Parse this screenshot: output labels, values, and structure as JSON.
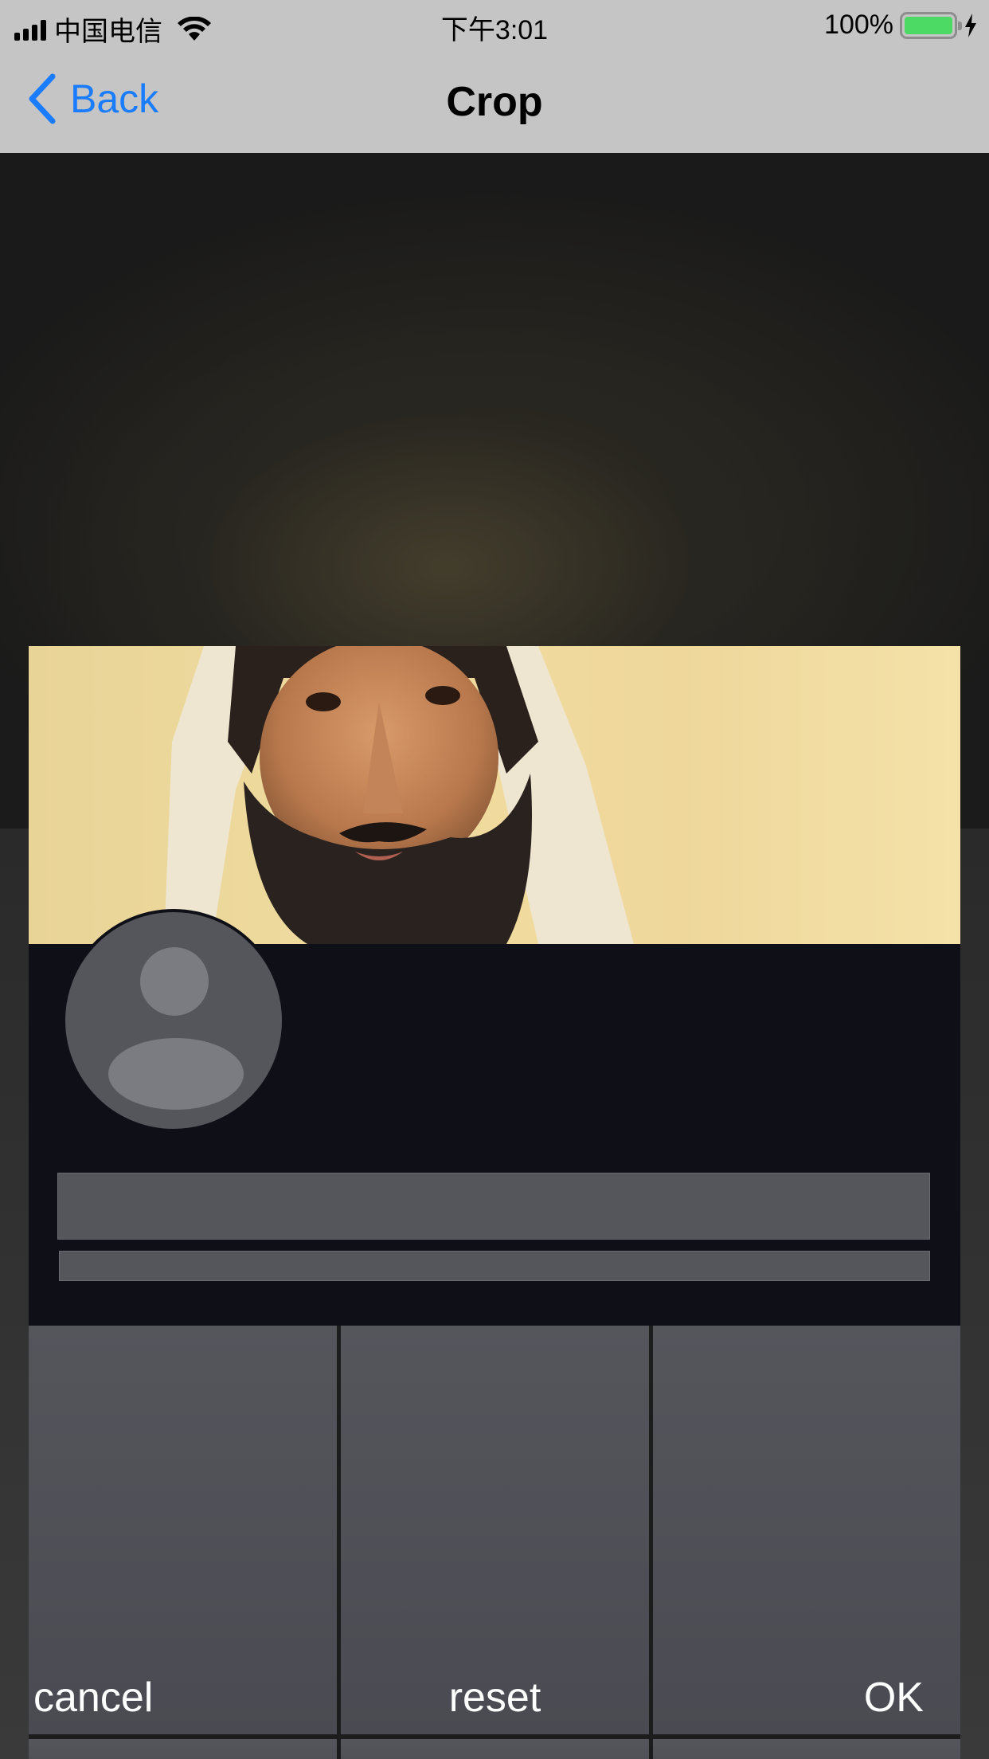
{
  "status_bar": {
    "carrier": "中国电信",
    "time": "下午3:01",
    "battery_percent": "100%",
    "battery_level": 1.0,
    "battery_color": "#4cd964"
  },
  "nav": {
    "back_label": "Back",
    "title": "Crop",
    "accent_color": "#1a7cff"
  },
  "actions": {
    "cancel_label": "cancel",
    "reset_label": "reset",
    "ok_label": "OK"
  },
  "icons": [
    "signal-icon",
    "wifi-icon",
    "battery-icon",
    "charging-bolt-icon",
    "back-chevron-icon",
    "avatar-placeholder-icon"
  ]
}
